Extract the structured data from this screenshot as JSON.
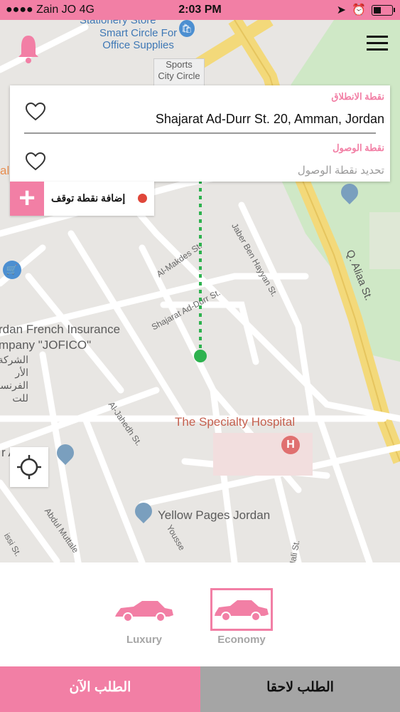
{
  "status_bar": {
    "carrier": "Zain JO",
    "network": "4G",
    "time": "2:03 PM"
  },
  "map": {
    "labels": {
      "stationery": "Stationery Store",
      "smart_circle": "Smart Circle For\nOffice Supplies",
      "sports_city": "Sports\nCity Circle",
      "q_aliaa": "Q. Aliaa St.",
      "al_makdes": "Al-Makdes St.",
      "jaber": "Jaber Ben Hayyan St.",
      "shajarat": "Shajarat Ad-Durr St.",
      "insurance": "rdan French Insurance\nmpany \"JOFICO\"",
      "insurance_ar": "الشركة الأر\nالفرنسية للت",
      "al_jahedh": "Al-Jahedh St.",
      "hospital": "The Specialty Hospital",
      "yellow_pages": "Yellow Pages Jordan",
      "abdul": "Abdul Muttale",
      "youss": "Yousse",
      "ali": "Iali St.",
      "issi": "issi St.",
      "left_a": "r A",
      "ala": "ala",
      "am": "Am"
    }
  },
  "route_card": {
    "pickup_label": "نقطة الانطلاق",
    "pickup_value": "Shajarat Ad-Durr St. 20, Amman, Jordan",
    "dropoff_label": "نقطة الوصول",
    "dropoff_placeholder": "تحديد نقطة الوصول"
  },
  "add_stop": {
    "label": "إضافة نقطة توقف",
    "icon": "+"
  },
  "car_options": [
    {
      "name": "Luxury",
      "selected": false
    },
    {
      "name": "Economy",
      "selected": true
    }
  ],
  "buttons": {
    "order_now": "الطلب الآن",
    "order_later": "الطلب لاحقا"
  },
  "colors": {
    "accent": "#f27fa5",
    "route": "#2eb24f",
    "stop_dot": "#e0473a"
  }
}
